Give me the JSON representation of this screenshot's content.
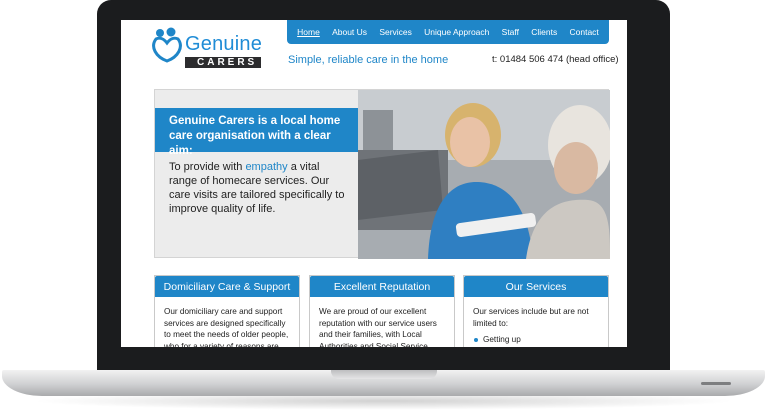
{
  "site": {
    "logo_word": "Genuine",
    "logo_sub": "CARERS",
    "tagline": "Simple, reliable care in the home",
    "phone": "t: 01484 506 474 (head office)"
  },
  "nav": {
    "items": [
      "Home",
      "About Us",
      "Services",
      "Unique Approach",
      "Staff",
      "Clients",
      "Contact"
    ]
  },
  "hero": {
    "heading": "Genuine Carers is a local home care organisation with a clear aim:",
    "text_before": "To provide with ",
    "text_highlight": "empathy",
    "text_after": " a vital range of homecare services. Our care visits are tailored specifically to improve quality of life."
  },
  "cards": [
    {
      "title": "Domiciliary Care & Support",
      "body": "Our domiciliary care and support services are designed specifically to meet the needs of older people, who for a variety of reasons are"
    },
    {
      "title": "Excellent Reputation",
      "body": "We are proud of our excellent reputation with our service users and their families, with Local Authorities and Social Service"
    },
    {
      "title": "Our Services",
      "body": "Our services include but are not limited to:",
      "list": [
        "Getting up"
      ]
    }
  ],
  "colors": {
    "brand_blue": "#1f86c8",
    "bezel": "#1b1c1e",
    "hero_bg": "#ececec"
  }
}
